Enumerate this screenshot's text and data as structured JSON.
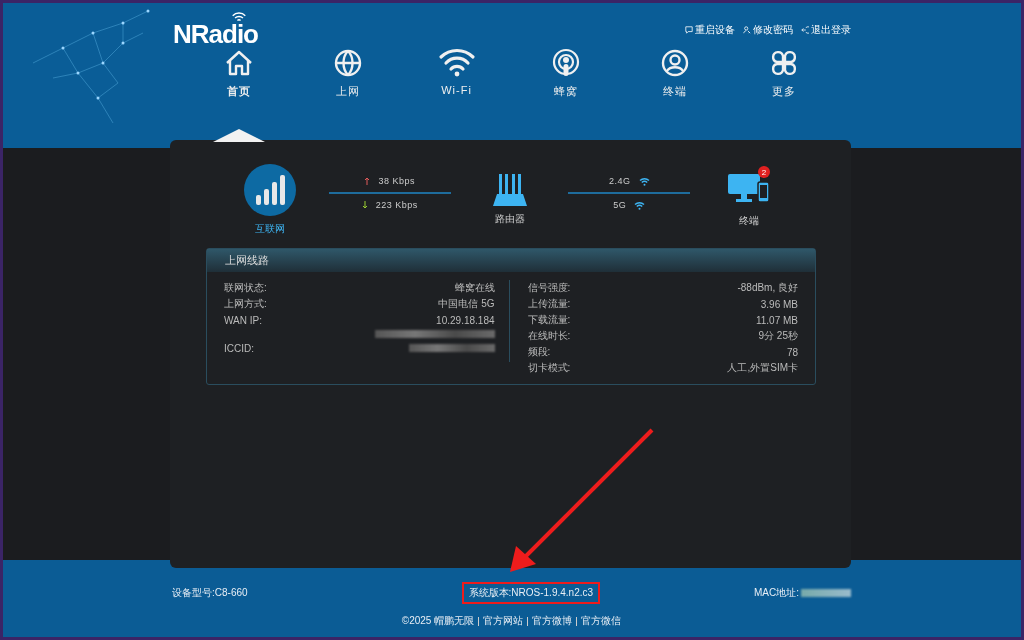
{
  "brand": {
    "logo": "NRadio"
  },
  "top_links": [
    {
      "kind": "reboot",
      "label": "重启设备"
    },
    {
      "kind": "password",
      "label": "修改密码"
    },
    {
      "kind": "logout",
      "label": "退出登录"
    }
  ],
  "nav": [
    {
      "kind": "home",
      "label": "首页",
      "selected": true
    },
    {
      "kind": "globe",
      "label": "上网",
      "selected": false
    },
    {
      "kind": "wifi",
      "label": "Wi-Fi",
      "selected": false
    },
    {
      "kind": "cellular",
      "label": "蜂窝",
      "selected": false
    },
    {
      "kind": "user",
      "label": "终端",
      "selected": false
    },
    {
      "kind": "more",
      "label": "更多",
      "selected": false
    }
  ],
  "status": {
    "internet": "互联网",
    "upload": "38 Kbps",
    "download": "223 Kbps",
    "router": "路由器",
    "band_24": "2.4G",
    "band_5": "5G",
    "terminal": "终端",
    "terminal_count": "2"
  },
  "panel": {
    "title": "上网线路",
    "left": [
      {
        "label": "联网状态:",
        "value": "蜂窝在线"
      },
      {
        "label": "上网方式:",
        "value": "中国电信 5G"
      },
      {
        "label": "WAN IP:",
        "value": "10.29.18.184",
        "redacted": true
      },
      {
        "label": "ICCID:",
        "redacted": true
      }
    ],
    "right": [
      {
        "label": "信号强度:",
        "value": "-88dBm, 良好"
      },
      {
        "label": "上传流量:",
        "value": "3.96 MB"
      },
      {
        "label": "下载流量:",
        "value": "11.07 MB"
      },
      {
        "label": "在线时长:",
        "value": "9分 25秒"
      },
      {
        "label": "频段:",
        "value": "78"
      },
      {
        "label": "切卡模式:",
        "value": "人工,外置SIM卡"
      }
    ]
  },
  "footer": {
    "model": "设备型号:C8-660",
    "version": "系统版本:NROS-1.9.4.n2.c3",
    "mac": {
      "label": "MAC地址:",
      "redacted": true
    },
    "links": [
      "©2025 帽鹏无限",
      "官方网站",
      "官方微博",
      "官方微信"
    ]
  }
}
